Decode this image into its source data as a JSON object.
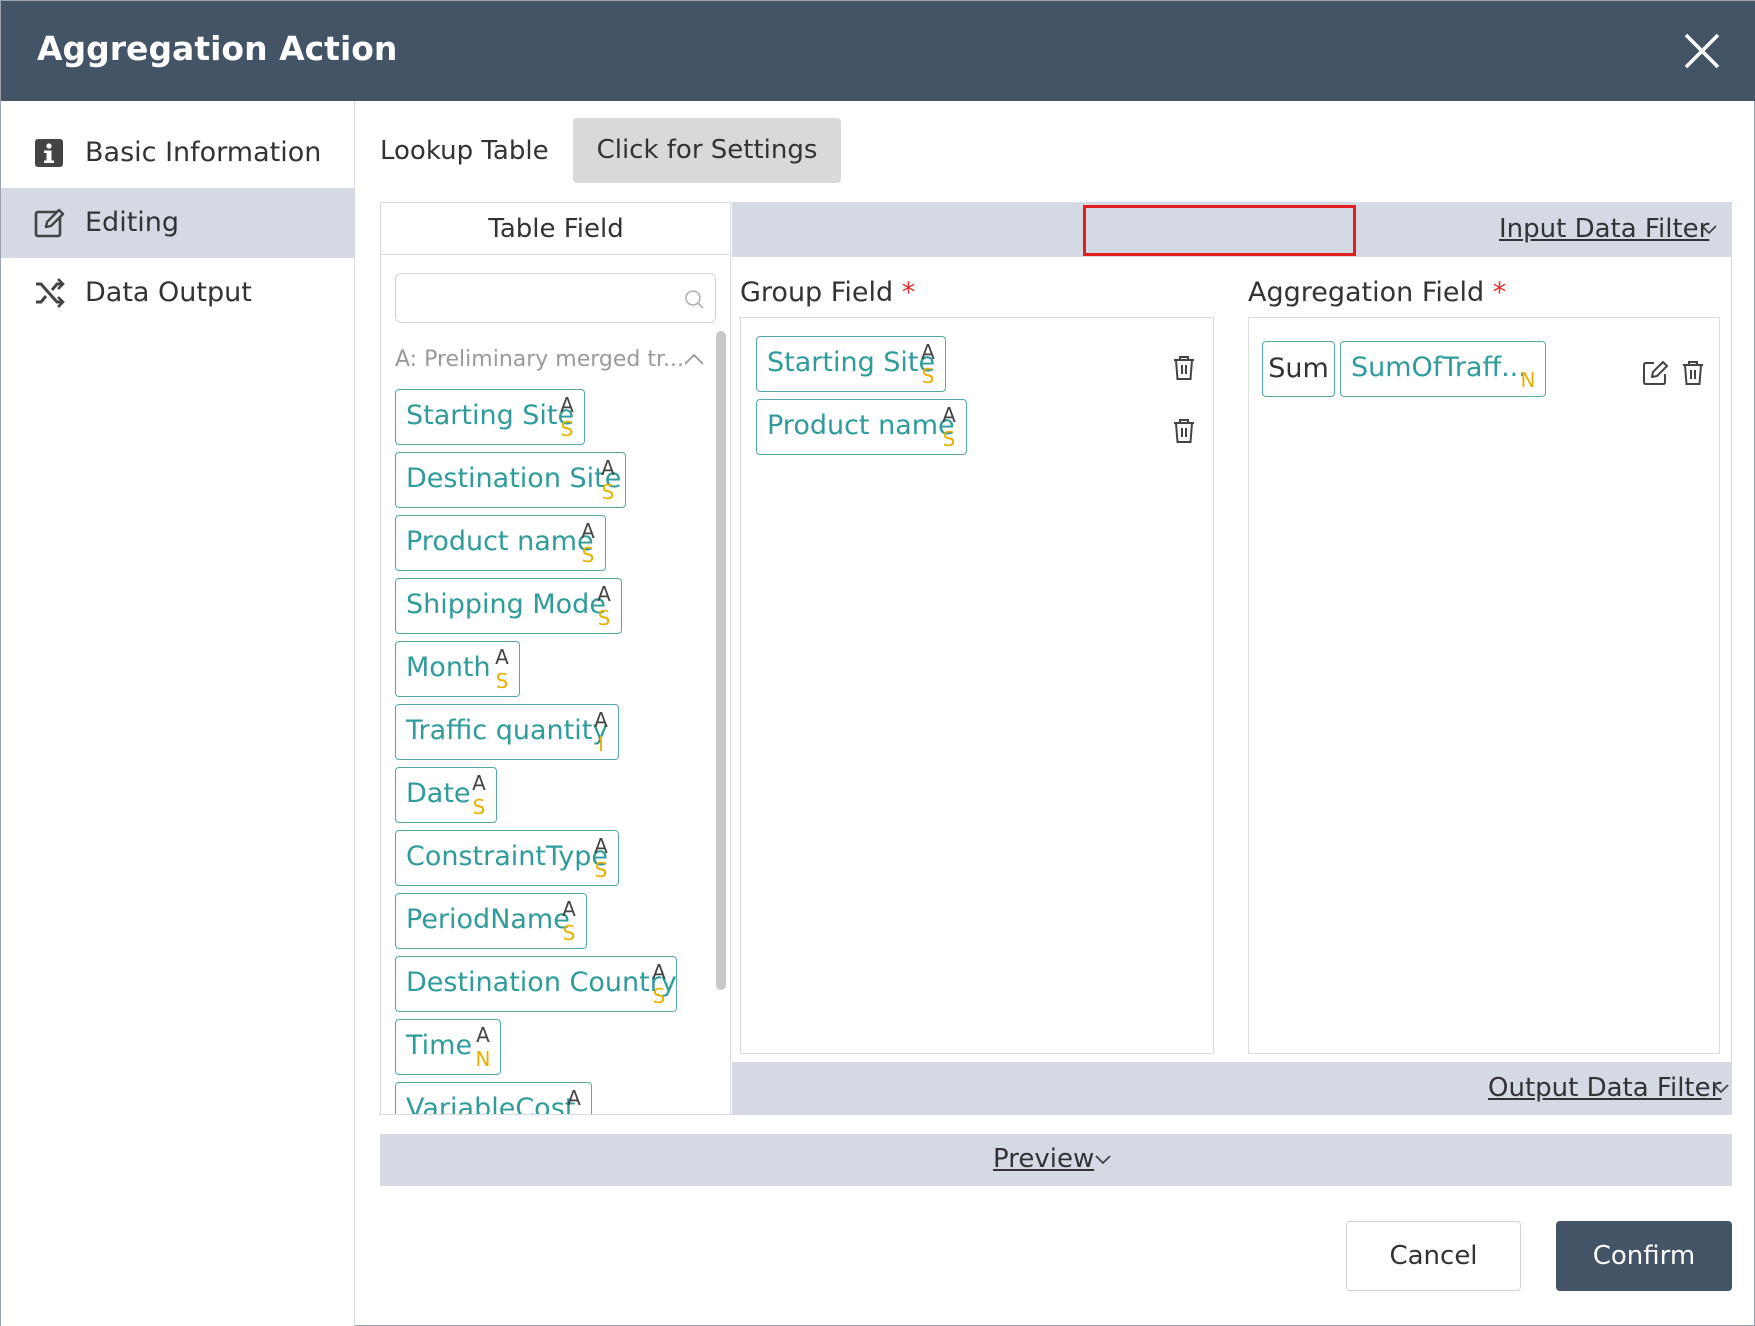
{
  "dialog": {
    "title": "Aggregation Action",
    "close_icon": "close-icon"
  },
  "sidebar": {
    "items": [
      {
        "label": "Basic Information",
        "icon": "info-icon",
        "active": false
      },
      {
        "label": "Editing",
        "icon": "edit-icon",
        "active": true
      },
      {
        "label": "Data Output",
        "icon": "shuffle-icon",
        "active": false
      }
    ]
  },
  "lookup": {
    "label": "Lookup Table",
    "button_label": "Click for Settings"
  },
  "table_field": {
    "header": "Table Field",
    "search_placeholder": "",
    "group_label": "A: Preliminary merged tr...",
    "fields": [
      {
        "name": "Starting Site",
        "type_top": "A",
        "type_bottom": "S"
      },
      {
        "name": "Destination Site",
        "type_top": "A",
        "type_bottom": "S"
      },
      {
        "name": "Product name",
        "type_top": "A",
        "type_bottom": "S"
      },
      {
        "name": "Shipping Mode",
        "type_top": "A",
        "type_bottom": "S"
      },
      {
        "name": "Month",
        "type_top": "A",
        "type_bottom": "S"
      },
      {
        "name": "Traffic quantity",
        "type_top": "A",
        "type_bottom": "I"
      },
      {
        "name": "Date",
        "type_top": "A",
        "type_bottom": "S"
      },
      {
        "name": "ConstraintType",
        "type_top": "A",
        "type_bottom": "S"
      },
      {
        "name": "PeriodName",
        "type_top": "A",
        "type_bottom": "S"
      },
      {
        "name": "Destination Country",
        "type_top": "A",
        "type_bottom": "S"
      },
      {
        "name": "Time",
        "type_top": "A",
        "type_bottom": "N"
      },
      {
        "name": "VariableCost",
        "type_top": "A",
        "type_bottom": ""
      }
    ]
  },
  "input_filter": {
    "label": "Input Data Filter"
  },
  "output_filter": {
    "label": "Output Data Filter"
  },
  "group_field": {
    "label": "Group Field",
    "required_mark": "*",
    "items": [
      {
        "name": "Starting Site",
        "type_top": "A",
        "type_bottom": "S"
      },
      {
        "name": "Product name",
        "type_top": "A",
        "type_bottom": "S"
      }
    ]
  },
  "aggregation_field": {
    "label": "Aggregation Field",
    "required_mark": "*",
    "items": [
      {
        "operator": "Sum",
        "name": "SumOfTraff...",
        "type": "N"
      }
    ]
  },
  "preview": {
    "label": "Preview"
  },
  "footer": {
    "cancel_label": "Cancel",
    "confirm_label": "Confirm"
  },
  "colors": {
    "titlebar": "#435466",
    "active_nav": "#d4d9e4",
    "chip_text": "#2f9b9b",
    "type_badge": "#e8b000",
    "required": "#e03030",
    "highlight": "#e02020",
    "confirm": "#435466"
  }
}
